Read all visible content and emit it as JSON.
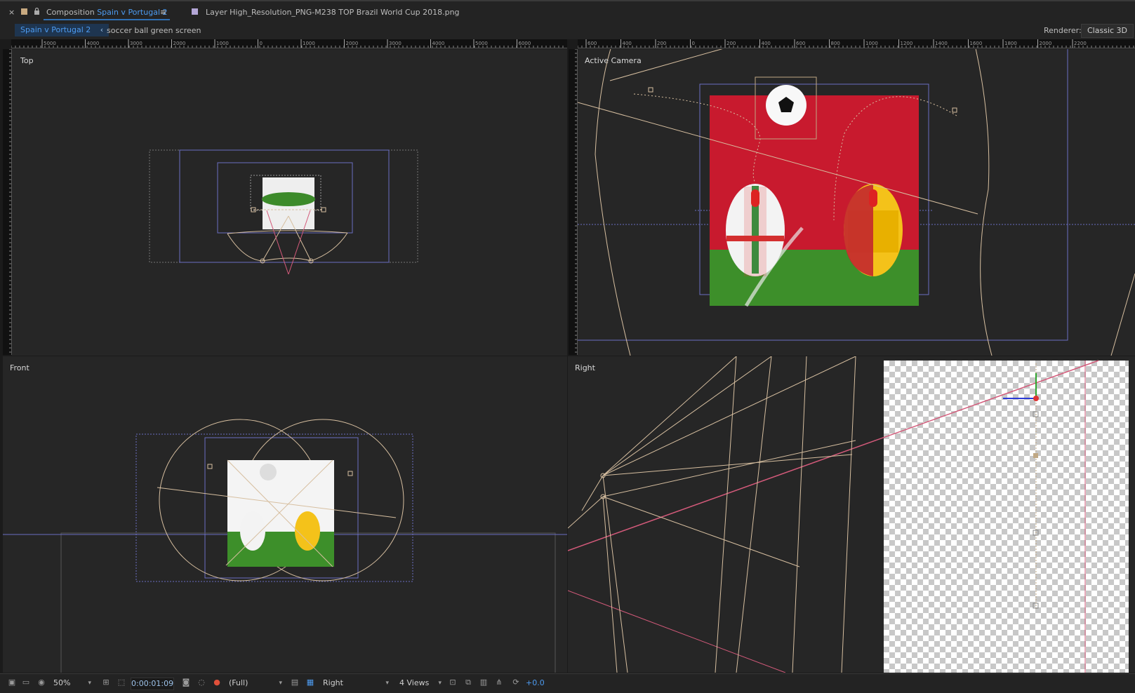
{
  "tabs": {
    "close_symbol": "×",
    "composition_prefix": "Composition",
    "composition_name": "Spain v Portugal 2",
    "menu_symbol": "≡",
    "layer_tab": "Layer High_Resolution_PNG-M238 TOP Brazil World Cup 2018.png"
  },
  "breadcrumb": {
    "active": "Spain v Portugal 2",
    "arrow": "‹",
    "secondary": "soccer ball green screen"
  },
  "renderer": {
    "label": "Renderer:",
    "value": "Classic 3D"
  },
  "rulers": {
    "top_left": [
      "5000",
      "4000",
      "3000",
      "2000",
      "1000",
      "0",
      "1000",
      "2000",
      "3000",
      "4000",
      "5000",
      "6000"
    ],
    "top_right": [
      "600",
      "400",
      "200",
      "0",
      "200",
      "400",
      "600",
      "800",
      "1000",
      "1200",
      "1400",
      "1600",
      "1800",
      "2000",
      "2200"
    ]
  },
  "viewports": {
    "top": "Top",
    "active_camera": "Active Camera",
    "front": "Front",
    "right": "Right"
  },
  "toolbar": {
    "zoom": "50%",
    "timecode": "0:00:01:09",
    "resolution": "(Full)",
    "view": "Right",
    "layout": "4 Views",
    "exposure": "+0.0"
  },
  "colors": {
    "accent": "#4d9bf0",
    "panel_bg": "#262626",
    "camera_wire": "#d7bfa0",
    "motion_path": "#d35a7a",
    "comp_bounds": "#6b6fc2",
    "backdrop_red": "#c81a2e"
  }
}
